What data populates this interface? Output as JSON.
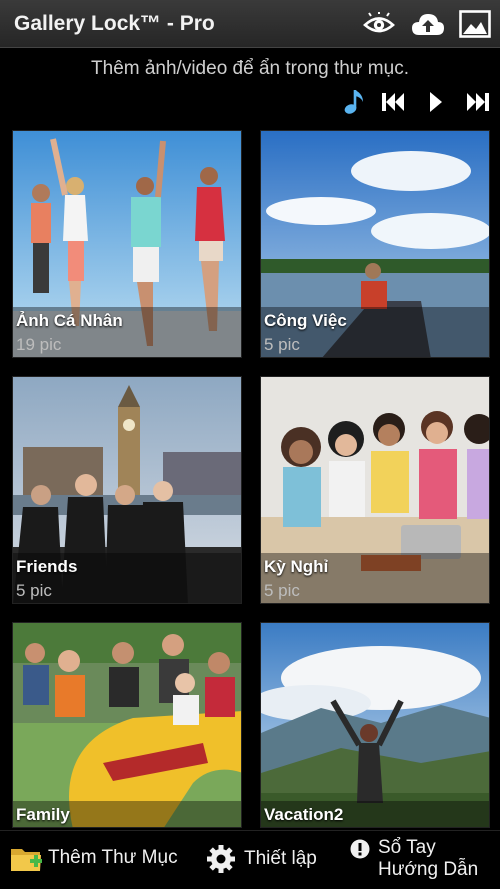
{
  "header": {
    "title": "Gallery Lock™ - Pro",
    "icons": [
      "eye-icon",
      "cloud-upload-icon",
      "image-icon"
    ]
  },
  "hint_text": "Thêm ảnh/video để ẩn trong thư mục.",
  "player": {
    "icons": [
      "music-note-icon",
      "rewind-icon",
      "play-icon",
      "fast-forward-icon"
    ],
    "accent": "#5ab4f0"
  },
  "albums": [
    {
      "name": "Ảnh Cá Nhân",
      "count": "19 pic"
    },
    {
      "name": "Công Việc",
      "count": "5 pic"
    },
    {
      "name": "Friends",
      "count": "5 pic"
    },
    {
      "name": "Kỳ Nghỉ",
      "count": "5 pic"
    },
    {
      "name": "Family"
    },
    {
      "name": "Vacation2"
    }
  ],
  "bottom_bar": {
    "add_folder": "Thêm Thư Mục",
    "settings": "Thiết lập",
    "guide_line1": "Sổ Tay",
    "guide_line2": "Hướng Dẫn"
  }
}
